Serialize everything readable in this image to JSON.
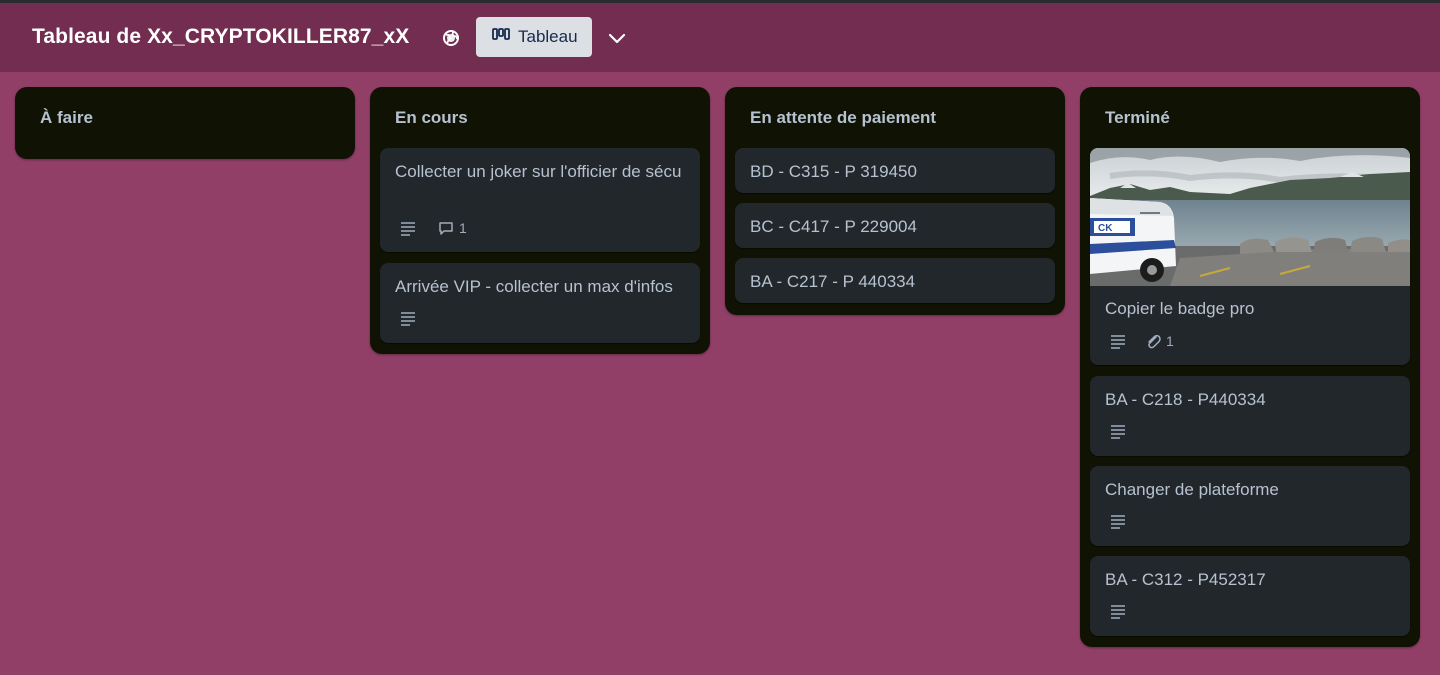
{
  "header": {
    "board_title": "Tableau de Xx_CRYPTOKILLER87_xX",
    "visibility_icon": "globe-icon",
    "view_button_label": "Tableau",
    "view_button_icon": "board-icon",
    "dropdown_icon": "chevron-down-icon"
  },
  "colors": {
    "background": "#913f66",
    "header": "#722d50",
    "list": "#101204",
    "card": "#22272b",
    "text": "#b6c2cf"
  },
  "lists": [
    {
      "title": "À faire",
      "cards": []
    },
    {
      "title": "En cours",
      "cards": [
        {
          "title": "Collecter un joker sur l'officier de sécu",
          "description": true,
          "comments": "1"
        },
        {
          "title": "Arrivée VIP - collecter un max d'infos",
          "description": true
        }
      ]
    },
    {
      "title": "En attente de paiement",
      "cards": [
        {
          "title": "BD - C315 - P 319450"
        },
        {
          "title": "BC - C417 - P 229004"
        },
        {
          "title": "BA - C217 - P 440334"
        }
      ]
    },
    {
      "title": "Terminé",
      "cards": [
        {
          "title": "Copier le badge pro",
          "cover": "lake-van-photo",
          "description": true,
          "attachments": "1"
        },
        {
          "title": "BA - C218 - P440334",
          "description": true
        },
        {
          "title": "Changer de plateforme",
          "description": true
        },
        {
          "title": "BA - C312 - P452317",
          "description": true
        }
      ]
    }
  ]
}
